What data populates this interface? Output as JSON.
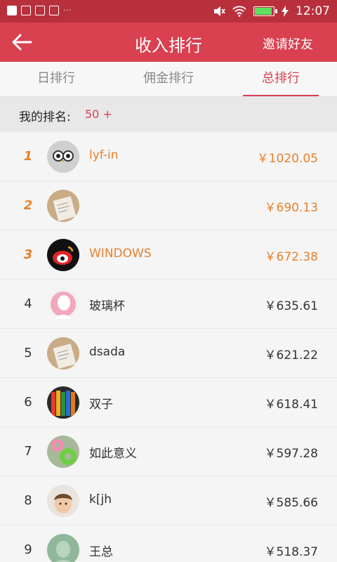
{
  "status": {
    "time": "12:07"
  },
  "header": {
    "title": "收入排行",
    "invite": "邀请好友"
  },
  "tabs": [
    {
      "label": "日排行",
      "active": false
    },
    {
      "label": "佣金排行",
      "active": false
    },
    {
      "label": "总排行",
      "active": true
    }
  ],
  "my_rank": {
    "label": "我的排名:",
    "value": "50 +"
  },
  "ranking": [
    {
      "rank": "1",
      "name": "lyf-in",
      "amount": "￥1020.05",
      "avatar": "owl-avatar"
    },
    {
      "rank": "2",
      "name": "",
      "amount": "￥690.13",
      "avatar": "paper-avatar"
    },
    {
      "rank": "3",
      "name": "WINDOWS",
      "amount": "￥672.38",
      "avatar": "weibo-avatar"
    },
    {
      "rank": "4",
      "name": "玻璃杯",
      "amount": "￥635.61",
      "avatar": "pink-avatar"
    },
    {
      "rank": "5",
      "name": "dsada",
      "amount": "￥621.22",
      "avatar": "paper-avatar"
    },
    {
      "rank": "6",
      "name": "双子",
      "amount": "￥618.41",
      "avatar": "pencils-avatar"
    },
    {
      "rank": "7",
      "name": "如此意义",
      "amount": "￥597.28",
      "avatar": "donut-avatar"
    },
    {
      "rank": "8",
      "name": "k[jh",
      "amount": "￥585.66",
      "avatar": "child-avatar"
    },
    {
      "rank": "9",
      "name": "王总",
      "amount": "￥518.37",
      "avatar": "sketch-avatar"
    }
  ]
}
